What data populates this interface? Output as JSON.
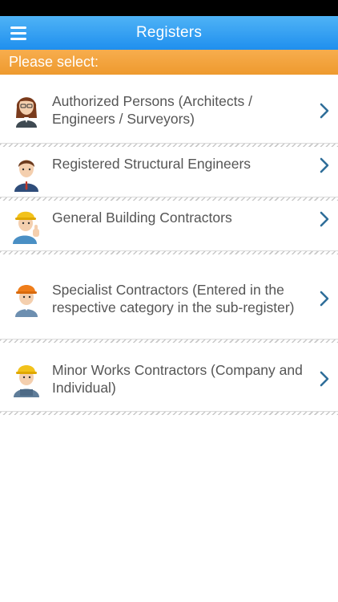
{
  "header": {
    "title": "Registers"
  },
  "prompt": "Please select:",
  "rows": [
    {
      "label": "Authorized Persons (Architects / Engineers / Surveyors)",
      "icon": "female-professional-icon"
    },
    {
      "label": "Registered Structural Engineers",
      "icon": "male-engineer-icon"
    },
    {
      "label": "General Building Contractors",
      "icon": "worker-hardhat-thumbs-up-icon"
    },
    {
      "label": "Specialist Contractors (Entered in the respective category in the sub-register)",
      "icon": "worker-orange-hardhat-icon"
    },
    {
      "label": "Minor Works Contractors (Company and Individual)",
      "icon": "worker-yellow-hardhat-icon"
    }
  ],
  "colors": {
    "nav": "#1f8fee",
    "prompt_bar": "#ee9a2f",
    "chevron": "#2f6e99",
    "text": "#555555"
  }
}
